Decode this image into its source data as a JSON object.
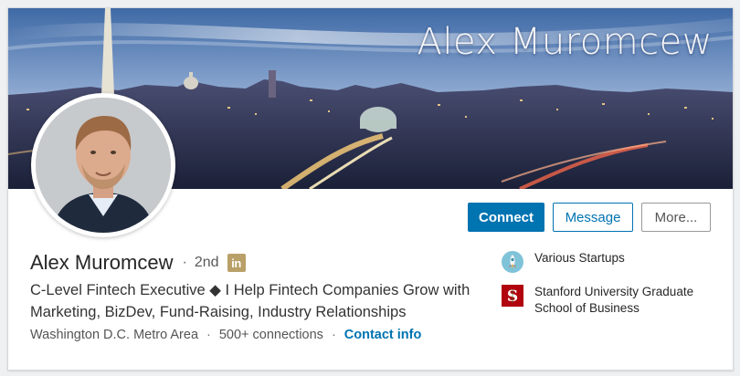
{
  "profile": {
    "banner_title": "Alex Muromcew",
    "name": "Alex Muromcew",
    "separator": "·",
    "degree": "2nd",
    "badge_text": "in",
    "headline": "C-Level Fintech Executive ◆ I Help Fintech Companies Grow with Marketing, BizDev, Fund-Raising, Industry Relationships",
    "location": "Washington D.C. Metro Area",
    "connections": "500+ connections",
    "contact_info": "Contact info"
  },
  "actions": {
    "connect": "Connect",
    "message": "Message",
    "more": "More..."
  },
  "side": {
    "company": "Various Startups",
    "school": "Stanford University Graduate School of Business"
  },
  "colors": {
    "brand": "#0073b1",
    "badge": "#b8a068",
    "stanford": "#b1040e"
  },
  "icons": {
    "company_logo": "startup-rocket-icon",
    "school_logo": "stanford-s-logo-icon",
    "premium_badge": "linkedin-premium-icon"
  }
}
